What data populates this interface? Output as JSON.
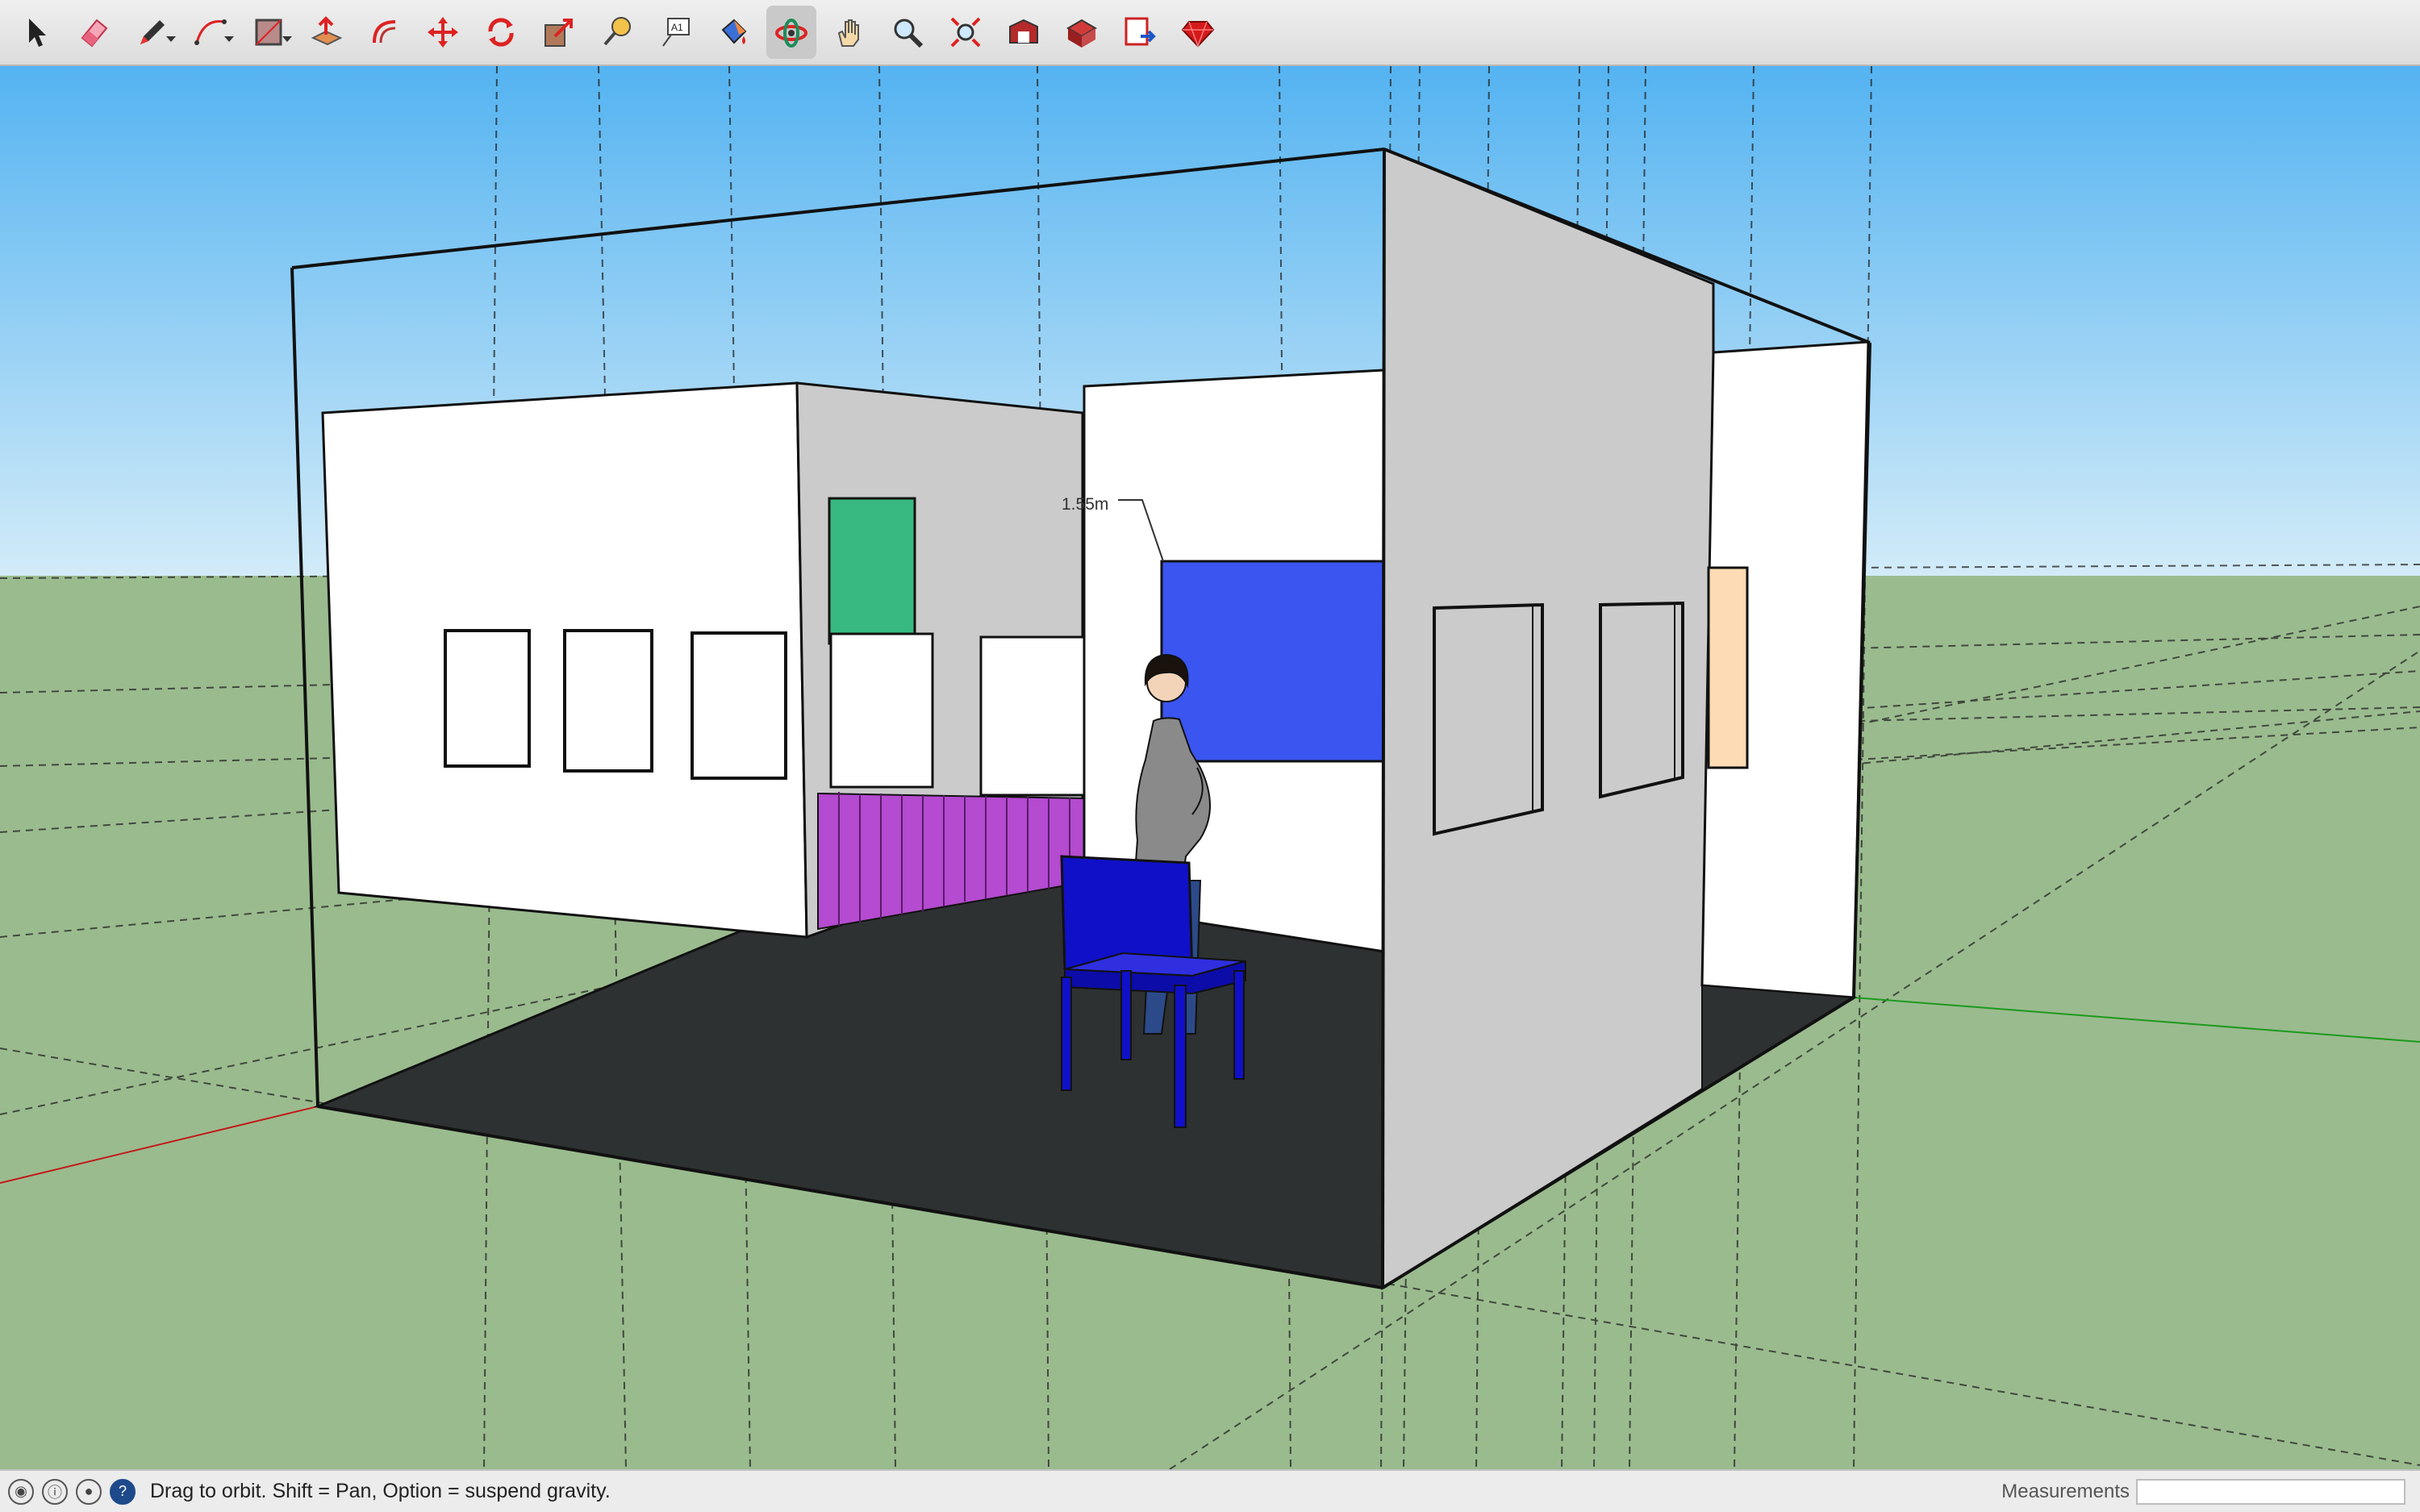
{
  "toolbar": {
    "tools": [
      {
        "name": "select-icon",
        "label": "Select"
      },
      {
        "name": "eraser-icon",
        "label": "Eraser"
      },
      {
        "name": "pencil-icon",
        "label": "Line"
      },
      {
        "name": "arc-icon",
        "label": "Arc"
      },
      {
        "name": "rectangle-icon",
        "label": "Rectangle"
      },
      {
        "name": "push-pull-icon",
        "label": "Push/Pull"
      },
      {
        "name": "offset-icon",
        "label": "Offset"
      },
      {
        "name": "move-icon",
        "label": "Move"
      },
      {
        "name": "rotate-icon",
        "label": "Rotate"
      },
      {
        "name": "scale-icon",
        "label": "Scale"
      },
      {
        "name": "tape-measure-icon",
        "label": "Tape Measure"
      },
      {
        "name": "text-icon",
        "label": "Text"
      },
      {
        "name": "paint-bucket-icon",
        "label": "Paint Bucket"
      },
      {
        "name": "orbit-icon",
        "label": "Orbit",
        "active": true
      },
      {
        "name": "pan-icon",
        "label": "Pan"
      },
      {
        "name": "zoom-icon",
        "label": "Zoom"
      },
      {
        "name": "zoom-extents-icon",
        "label": "Zoom Extents"
      },
      {
        "name": "warehouse-icon",
        "label": "3D Warehouse"
      },
      {
        "name": "extension-warehouse-icon",
        "label": "Extension Warehouse"
      },
      {
        "name": "send-to-layout-icon",
        "label": "Send to LayOut"
      },
      {
        "name": "ruby-console-icon",
        "label": "Ruby Console"
      }
    ],
    "text_tool_glyph": "A1"
  },
  "viewport": {
    "dimension_label": "1.55m",
    "colors": {
      "sky": "#7cc3f5",
      "ground": "#9abb8e",
      "floor": "#2e3131",
      "wall_shade": "#cbcbcb",
      "chair": "#1010c8",
      "blue_panel": "#3a55f0",
      "green_panel": "#37b981",
      "magenta": "#b44bd0",
      "peach": "#fddbb4"
    }
  },
  "status": {
    "text": "Drag to orbit. Shift = Pan, Option = suspend gravity.",
    "measurements_label": "Measurements",
    "measurements_value": ""
  }
}
